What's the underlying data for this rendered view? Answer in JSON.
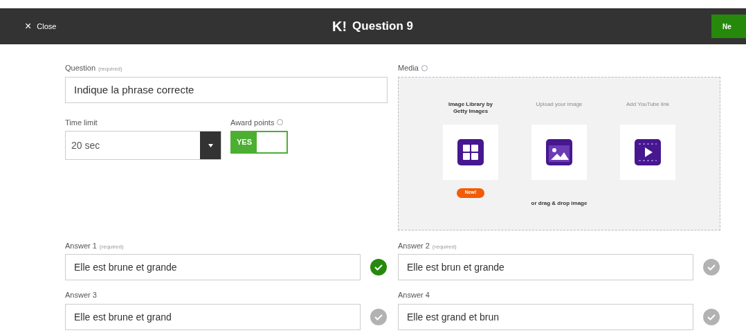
{
  "header": {
    "close": {
      "icon": "×",
      "label": "Close"
    },
    "logo": "K!",
    "title": "Question 9",
    "next_button": "Ne"
  },
  "question": {
    "label": "Question",
    "hint": "(required)",
    "value": "Indique la phrase correcte"
  },
  "time_limit": {
    "label": "Time limit",
    "value": "20 sec"
  },
  "award_points": {
    "label": "Award points",
    "on": true,
    "on_label": "YES"
  },
  "media": {
    "label": "Media",
    "options": [
      {
        "label": "Image Library by Getty Images",
        "bold": true,
        "kind": "grid",
        "badge": "New!"
      },
      {
        "label": "Upload your image",
        "bold": false,
        "kind": "image"
      },
      {
        "label": "Add YouTube link",
        "bold": false,
        "kind": "video"
      }
    ],
    "drop_text": "or drag & drop image"
  },
  "answers": [
    {
      "label": "Answer 1",
      "hint": "(required)",
      "value": "Elle est brune et grande",
      "checked": true
    },
    {
      "label": "Answer 2",
      "hint": "(required)",
      "value": "Elle est brun et grande",
      "checked": false
    },
    {
      "label": "Answer 3",
      "value": "Elle est brune et grand",
      "checked": false
    },
    {
      "label": "Answer 4",
      "value": "Elle est grand et brun",
      "checked": false
    }
  ]
}
